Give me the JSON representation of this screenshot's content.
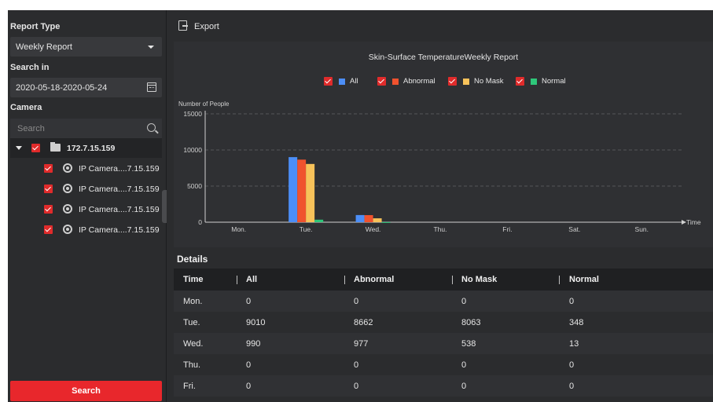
{
  "sidebar": {
    "report_type_label": "Report Type",
    "report_type_value": "Weekly Report",
    "search_in_label": "Search in",
    "date_range": "2020-05-18-2020-05-24",
    "camera_label": "Camera",
    "camera_search_placeholder": "Search",
    "tree": {
      "root": "172.7.15.159",
      "children": [
        "IP Camera....7.15.159",
        "IP Camera....7.15.159",
        "IP Camera....7.15.159",
        "IP Camera....7.15.159"
      ]
    },
    "search_button": "Search"
  },
  "toolbar": {
    "export_label": "Export"
  },
  "chart": {
    "legend": [
      "All",
      "Abnormal",
      "No Mask",
      "Normal"
    ]
  },
  "chart_data": {
    "type": "bar",
    "title": "Skin-Surface TemperatureWeekly Report",
    "ylabel": "Number of People",
    "xlabel": "Time",
    "ylim": [
      0,
      15000
    ],
    "yticks": [
      0,
      5000,
      10000,
      15000
    ],
    "categories": [
      "Mon.",
      "Tue.",
      "Wed.",
      "Thu.",
      "Fri.",
      "Sat.",
      "Sun."
    ],
    "series": [
      {
        "name": "All",
        "color": "#4c8ef7",
        "values": [
          0,
          9010,
          990,
          0,
          0,
          0,
          0
        ]
      },
      {
        "name": "Abnormal",
        "color": "#f0522e",
        "values": [
          0,
          8662,
          977,
          0,
          0,
          0,
          0
        ]
      },
      {
        "name": "No Mask",
        "color": "#f7c25a",
        "values": [
          0,
          8063,
          538,
          0,
          0,
          0,
          0
        ]
      },
      {
        "name": "Normal",
        "color": "#2ec77a",
        "values": [
          0,
          348,
          13,
          0,
          0,
          0,
          0
        ]
      }
    ],
    "grid": true,
    "legend_position": "top-center"
  },
  "details": {
    "title": "Details",
    "columns": [
      "Time",
      "All",
      "Abnormal",
      "No Mask",
      "Normal"
    ],
    "rows": [
      [
        "Mon.",
        "0",
        "0",
        "0",
        "0"
      ],
      [
        "Tue.",
        "9010",
        "8662",
        "8063",
        "348"
      ],
      [
        "Wed.",
        "990",
        "977",
        "538",
        "13"
      ],
      [
        "Thu.",
        "0",
        "0",
        "0",
        "0"
      ],
      [
        "Fri.",
        "0",
        "0",
        "0",
        "0"
      ]
    ]
  }
}
